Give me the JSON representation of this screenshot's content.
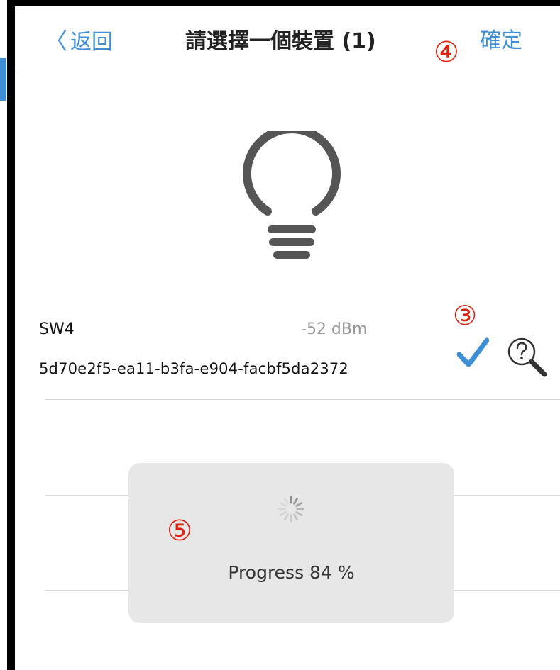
{
  "nav": {
    "back_chevron": "〈",
    "back_label": "返回",
    "title": "請選擇一個裝置 (1)",
    "confirm_label": "確定"
  },
  "device": {
    "icon": "lightbulb-icon",
    "name": "SW4",
    "rssi": "-52 dBm",
    "uuid": "5d70e2f5-ea11-b3fa-e904-facbf5da2372",
    "selected": true,
    "actions": [
      "check-icon",
      "search-help-icon"
    ]
  },
  "progress": {
    "label": "Progress 84 %",
    "percent": 84
  },
  "markers": {
    "confirm": "④",
    "check": "③",
    "progress": "⑤"
  },
  "colors": {
    "accent": "#3d8fd8",
    "marker": "#e0200f",
    "icon_dark": "#555555",
    "hud_bg": "#e7e7e7"
  }
}
